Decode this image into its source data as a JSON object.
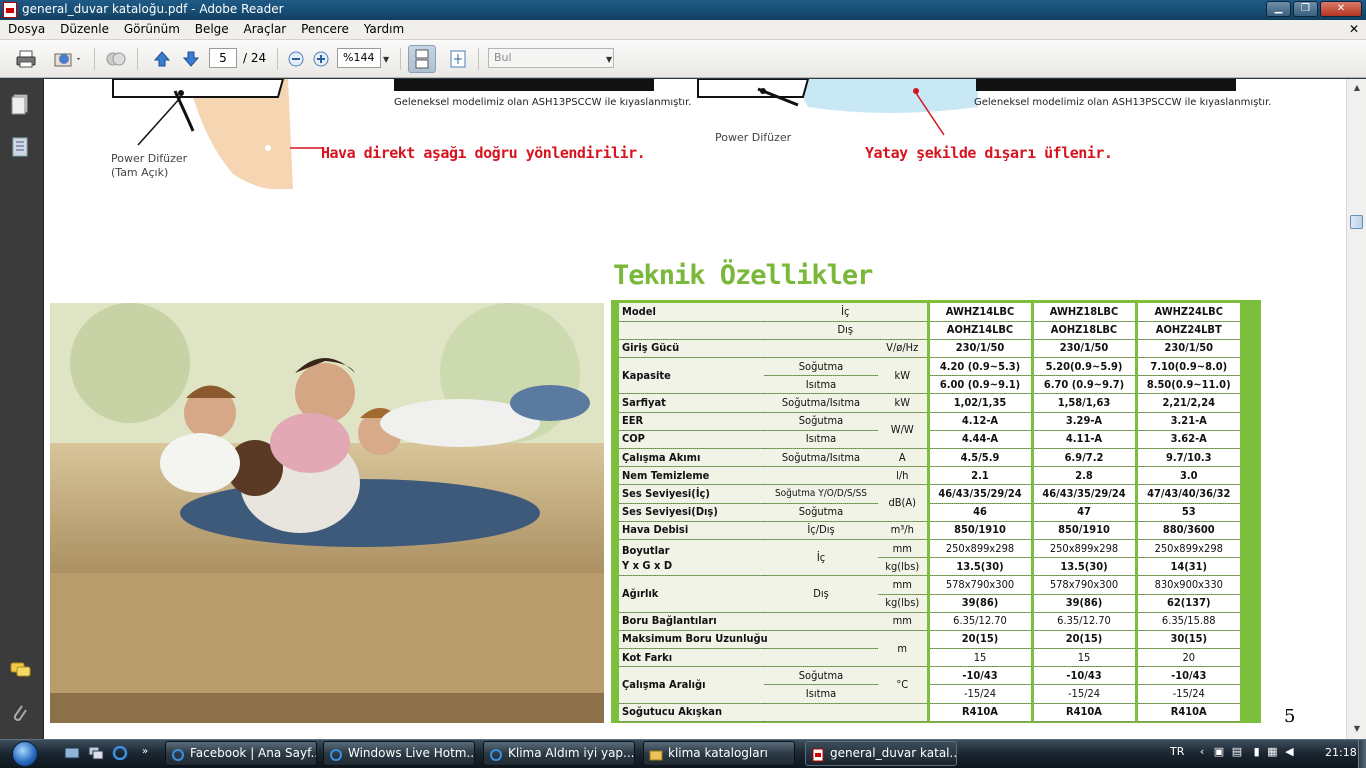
{
  "window": {
    "title": "general_duvar kataloğu.pdf - Adobe Reader",
    "controls": {
      "minimize": "▁",
      "maximize": "❐",
      "close": "✕"
    }
  },
  "menu": {
    "items": [
      "Dosya",
      "Düzenle",
      "Görünüm",
      "Belge",
      "Araçlar",
      "Pencere",
      "Yardım"
    ],
    "close_doc": "✕"
  },
  "toolbar": {
    "page_current": "5",
    "page_total": "/ 24",
    "zoom": "%144",
    "find_placeholder": "Bul"
  },
  "document": {
    "caption_left_small": "Geleneksel modelimiz olan ASH13PSCCW ile kıyaslanmıştır.",
    "caption_right_small": "Geleneksel modelimiz olan ASH13PSCCW ile kıyaslanmıştır.",
    "power_left": "Power Difüzer",
    "power_left_sub": "(Tam Açık)",
    "power_right": "Power Difüzer",
    "red_left": "Hava direkt aşağı doğru yönlendirilir.",
    "red_right": "Yatay şekilde dışarı üflenir.",
    "section_title": "Teknik Özellikler",
    "page_number": "5",
    "spec": {
      "r_model": "Model",
      "r_ic": "İç",
      "r_dis": "Dış",
      "models_ic": [
        "AWHZ14LBC",
        "AWHZ18LBC",
        "AWHZ24LBC"
      ],
      "models_dis": [
        "AOHZ14LBC",
        "AOHZ18LBC",
        "AOHZ24LBT"
      ],
      "giris": {
        "label": "Giriş Gücü",
        "unit": "V/ø/Hz",
        "v": [
          "230/1/50",
          "230/1/50",
          "230/1/50"
        ]
      },
      "kapasite": {
        "label": "Kapasite",
        "sogutma": "Soğutma",
        "isitma": "Isıtma",
        "unit": "kW",
        "sog": [
          "4.20 (0.9~5.3)",
          "5.20(0.9~5.9)",
          "7.10(0.9~8.0)"
        ],
        "isi": [
          "6.00 (0.9~9.1)",
          "6.70 (0.9~9.7)",
          "8.50(0.9~11.0)"
        ]
      },
      "sarfiyat": {
        "label": "Sarfiyat",
        "sub": "Soğutma/Isıtma",
        "unit": "kW",
        "v": [
          "1,02/1,35",
          "1,58/1,63",
          "2,21/2,24"
        ]
      },
      "eer": {
        "label": "EER",
        "sub": "Soğutma",
        "unit": "W/W",
        "v": [
          "4.12-A",
          "3.29-A",
          "3.21-A"
        ]
      },
      "cop": {
        "label": "COP",
        "sub": "Isıtma",
        "v": [
          "4.44-A",
          "4.11-A",
          "3.62-A"
        ]
      },
      "akim": {
        "label": "Çalışma Akımı",
        "sub": "Soğutma/Isıtma",
        "unit": "A",
        "v": [
          "4.5/5.9",
          "6.9/7.2",
          "9.7/10.3"
        ]
      },
      "nem": {
        "label": "Nem Temizleme",
        "unit": "l/h",
        "v": [
          "2.1",
          "2.8",
          "3.0"
        ]
      },
      "ses_ic": {
        "label": "Ses Seviyesi(İç)",
        "sub1": "Soğutma",
        "sub2": "Y/O/D/S/SS",
        "unit": "dB(A)",
        "v": [
          "46/43/35/29/24",
          "46/43/35/29/24",
          "47/43/40/36/32"
        ]
      },
      "ses_dis": {
        "label": "Ses Seviyesi(Dış)",
        "sub": "Soğutma",
        "v": [
          "46",
          "47",
          "53"
        ]
      },
      "debi": {
        "label": "Hava Debisi",
        "sub": "İç/Dış",
        "unit": "m³/h",
        "v": [
          "850/1910",
          "850/1910",
          "880/3600"
        ]
      },
      "boyut": {
        "label": "Boyutlar",
        "label2": "Y x G x D",
        "sub_ic": "İç",
        "unit_mm": "mm",
        "unit_kg": "kg(lbs)",
        "ic_mm": [
          "250x899x298",
          "250x899x298",
          "250x899x298"
        ],
        "ic_kg": [
          "13.5(30)",
          "13.5(30)",
          "14(31)"
        ]
      },
      "agirlik": {
        "label": "Ağırlık",
        "sub_dis": "Dış",
        "dis_mm": [
          "578x790x300",
          "578x790x300",
          "830x900x330"
        ],
        "dis_kg": [
          "39(86)",
          "39(86)",
          "62(137)"
        ]
      },
      "boru": {
        "label": "Boru Bağlantıları",
        "unit": "mm",
        "v": [
          "6.35/12.70",
          "6.35/12.70",
          "6.35/15.88"
        ]
      },
      "uzunluk": {
        "label": "Maksimum Boru Uzunluğu",
        "unit": "m",
        "v": [
          "20(15)",
          "20(15)",
          "30(15)"
        ]
      },
      "kot": {
        "label": "Kot Farkı",
        "v": [
          "15",
          "15",
          "20"
        ]
      },
      "aralik": {
        "label": "Çalışma Aralığı",
        "sogutma": "Soğutma",
        "isitma": "Isıtma",
        "unit": "°C",
        "sog": [
          "-10/43",
          "-10/43",
          "-10/43"
        ],
        "isi": [
          "-15/24",
          "-15/24",
          "-15/24"
        ]
      },
      "akiskan": {
        "label": "Soğutucu Akışkan",
        "v": [
          "R410A",
          "R410A",
          "R410A"
        ]
      }
    }
  },
  "taskbar": {
    "tasks": [
      "Facebook | Ana Sayf...",
      "Windows Live Hotm...",
      "Klima Aldım iyi yap...",
      "klima katalogları",
      "general_duvar katal..."
    ],
    "lang": "TR",
    "time": "21:18"
  }
}
